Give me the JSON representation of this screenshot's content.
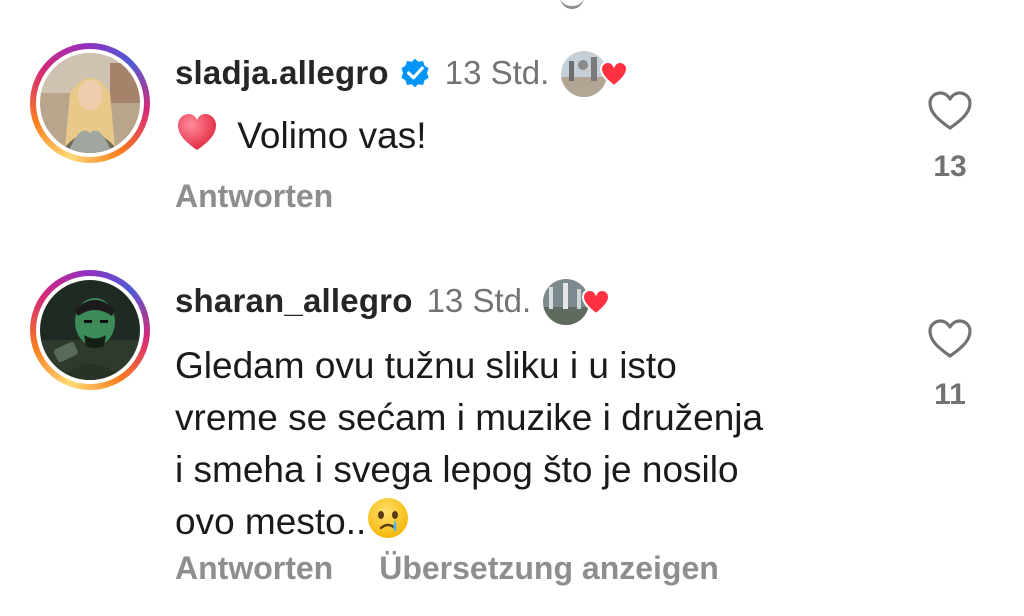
{
  "comments": [
    {
      "username": "sladja.allegro",
      "verified": true,
      "time": "13 Std.",
      "text": "Volimo vas!",
      "leading_emoji": "red-heart-emoji",
      "reply_label": "Antworten",
      "like_count": "13"
    },
    {
      "username": "sharan_allegro",
      "verified": false,
      "time": "13 Std.",
      "text_lines": [
        "Gledam ovu tužnu sliku i u isto",
        "vreme se sećam i muzike i druženja",
        "i smeha i svega lepog što je nosilo",
        "ovo mesto.."
      ],
      "trailing_emoji": "crying-face-emoji",
      "reply_label": "Antworten",
      "translate_label": "Übersetzung anzeigen",
      "like_count": "11"
    }
  ],
  "colors": {
    "verified_blue": "#0095f6",
    "heart_red": "#ff3040",
    "muted_text": "#8e8e8e"
  }
}
